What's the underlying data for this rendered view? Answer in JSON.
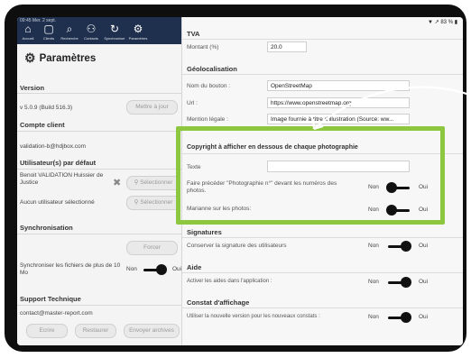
{
  "status": {
    "left": "09:45  Mer. 2 sept.",
    "right": "▼ ↗ 83 % ▮"
  },
  "nav": [
    {
      "label": "Accueil",
      "glyph": "⌂"
    },
    {
      "label": "Clients",
      "glyph": "▢"
    },
    {
      "label": "Recherche",
      "glyph": "⌕"
    },
    {
      "label": "Contacts",
      "glyph": "⚇"
    },
    {
      "label": "Synchroniser",
      "glyph": "↻"
    },
    {
      "label": "Paramètres",
      "glyph": "⚙"
    }
  ],
  "left": {
    "title": "Paramètres",
    "version": {
      "header": "Version",
      "value": "v 5.0.9 (Build 516.3)",
      "button": "Mettre à jour"
    },
    "compte": {
      "header": "Compte client",
      "value": "validation-b@hdjbox.com"
    },
    "users": {
      "header": "Utilisateur(s) par défaut",
      "row1": "Benoit VALIDATION Huissier de Justice",
      "row2": "Aucun utilisateur sélectionné",
      "select": "Sélectionner"
    },
    "sync": {
      "header": "Synchronisation",
      "force": "Forcer",
      "label": "Synchroniser les fichiers de plus de  10 Mo",
      "non": "Non",
      "oui": "Oui"
    },
    "support": {
      "header": "Support Technique",
      "email": "contact@master-report.com",
      "buttons": [
        "Ecrire",
        "Restaurer",
        "Envoyer archives"
      ]
    }
  },
  "right": {
    "tva": {
      "header": "TVA",
      "label": "Montant (%)",
      "value": "20.0"
    },
    "geo": {
      "header": "Géolocalisation",
      "bouton_label": "Nom du bouton :",
      "bouton_value": "OpenStreetMap",
      "url_label": "Url :",
      "url_value": "https://www.openstreetmap.org",
      "mention_label": "Mention légale :",
      "mention_value": "Image fournie à titre d'illustration (Source: ww..."
    },
    "copyright": {
      "header": "Copyright à afficher en dessous de chaque photographie",
      "texte_label": "Texte",
      "prefix_label": "Faire précéder \"Photographie n°\" devant les numéros des photos.",
      "marianne_label": "Marianne sur les photos:"
    },
    "signatures": {
      "header": "Signatures",
      "label": "Conserver la signature des utilisateurs"
    },
    "aide": {
      "header": "Aide",
      "label": "Activer les aides dans l'application :"
    },
    "constat": {
      "header": "Constat d'affichage",
      "label": "Utiliser la nouvelle version pour les nouveaux constats :"
    },
    "non": "Non",
    "oui": "Oui"
  },
  "colors": {
    "nav": "#1f2f4e",
    "highlight": "#8dc63f"
  }
}
